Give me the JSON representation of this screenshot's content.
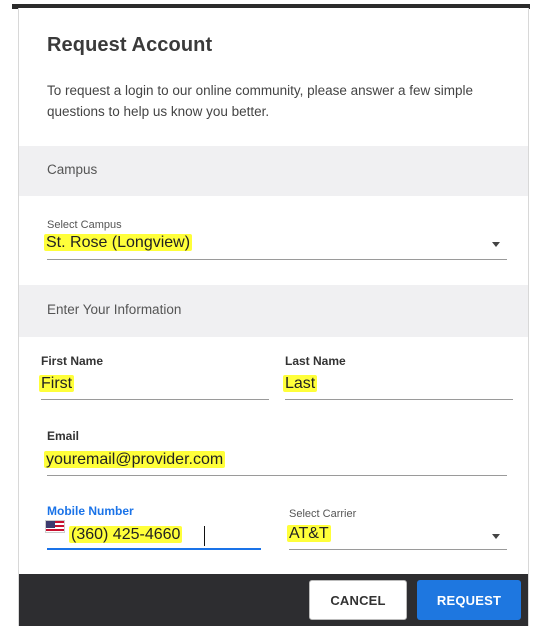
{
  "dialog": {
    "title": "Request Account",
    "intro": "To request a login to our online community, please answer a few simple questions to help us know you better."
  },
  "sections": {
    "campus": "Campus",
    "info": "Enter Your Information"
  },
  "campus_select": {
    "label": "Select Campus",
    "value": "St. Rose (Longview)"
  },
  "first_name": {
    "label": "First Name",
    "value": "First"
  },
  "last_name": {
    "label": "Last Name",
    "value": "Last"
  },
  "email": {
    "label": "Email",
    "value": "youremail@provider.com"
  },
  "mobile": {
    "label": "Mobile Number",
    "value": "(360) 425-4660",
    "flag_icon": "us-flag-icon"
  },
  "carrier_select": {
    "label": "Select Carrier",
    "value": "AT&T"
  },
  "footer": {
    "cancel_label": "CANCEL",
    "request_label": "REQUEST"
  },
  "colors": {
    "accent": "#1e77e0",
    "highlight": "#ffff3a",
    "footer_bg": "#2d2d30",
    "band_bg": "#f0f0f2"
  }
}
